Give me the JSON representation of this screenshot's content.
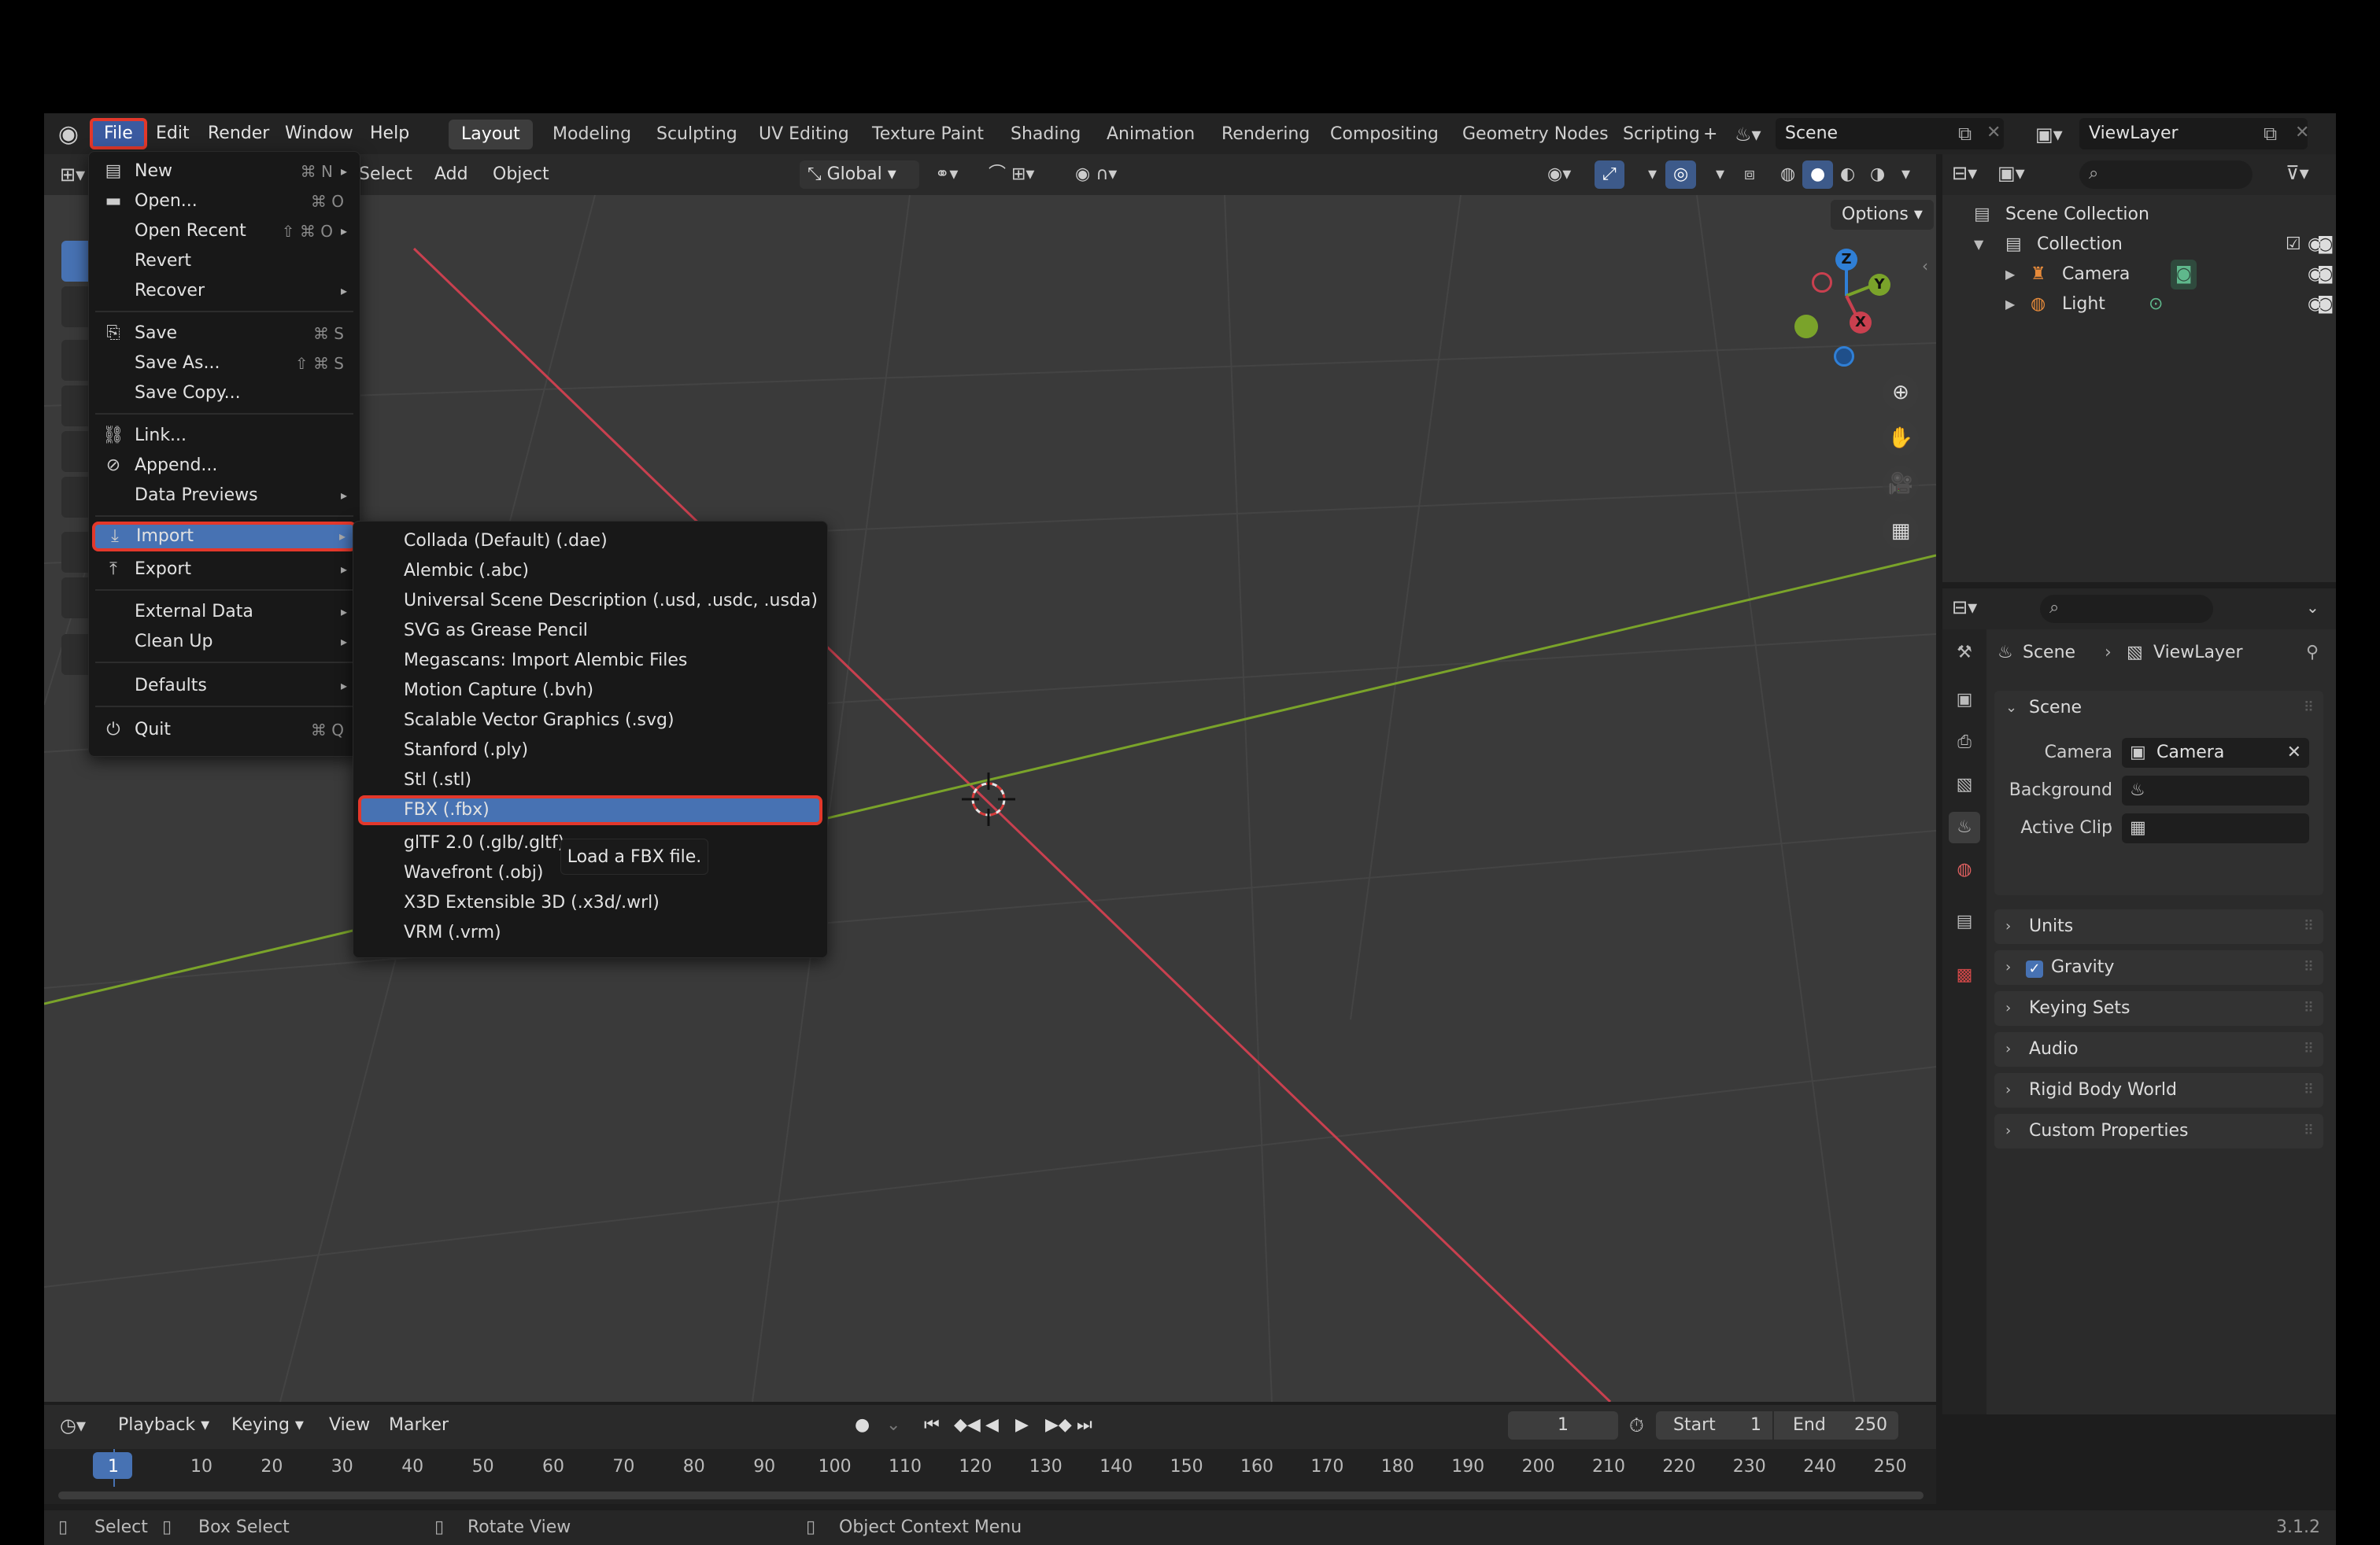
{
  "app": {
    "version": "3.1.2"
  },
  "top_menu": [
    "File",
    "Edit",
    "Render",
    "Window",
    "Help"
  ],
  "workspaces": [
    "Layout",
    "Modeling",
    "Sculpting",
    "UV Editing",
    "Texture Paint",
    "Shading",
    "Animation",
    "Rendering",
    "Compositing",
    "Geometry Nodes",
    "Scripting"
  ],
  "add_workspace": "+",
  "scene_name": "Scene",
  "view_layer": "ViewLayer",
  "viewport_header": {
    "select": "Select",
    "add": "Add",
    "object": "Object",
    "orientation": "Global",
    "options": "Options"
  },
  "gizmo": {
    "z": "Z",
    "y": "Y",
    "x": "X"
  },
  "file_menu": {
    "new": {
      "label": "New",
      "shortcut": "⌘ N"
    },
    "open": {
      "label": "Open...",
      "shortcut": "⌘ O"
    },
    "open_recent": {
      "label": "Open Recent",
      "shortcut": "⇧ ⌘ O"
    },
    "revert": {
      "label": "Revert"
    },
    "recover": {
      "label": "Recover"
    },
    "save": {
      "label": "Save",
      "shortcut": "⌘ S"
    },
    "save_as": {
      "label": "Save As...",
      "shortcut": "⇧ ⌘ S"
    },
    "save_copy": {
      "label": "Save Copy..."
    },
    "link": {
      "label": "Link..."
    },
    "append": {
      "label": "Append..."
    },
    "data_previews": {
      "label": "Data Previews"
    },
    "import": {
      "label": "Import"
    },
    "export": {
      "label": "Export"
    },
    "external_data": {
      "label": "External Data"
    },
    "clean_up": {
      "label": "Clean Up"
    },
    "defaults": {
      "label": "Defaults"
    },
    "quit": {
      "label": "Quit",
      "shortcut": "⌘ Q"
    }
  },
  "import_menu": [
    "Collada (Default) (.dae)",
    "Alembic (.abc)",
    "Universal Scene Description (.usd, .usdc, .usda)",
    "SVG as Grease Pencil",
    "Megascans: Import Alembic Files",
    "Motion Capture (.bvh)",
    "Scalable Vector Graphics (.svg)",
    "Stanford (.ply)",
    "Stl (.stl)",
    "FBX (.fbx)",
    "glTF 2.0 (.glb/.gltf)",
    "Wavefront (.obj)",
    "X3D Extensible 3D (.x3d/.wrl)",
    "VRM (.vrm)"
  ],
  "tooltip": "Load a FBX file.",
  "outliner": {
    "scene_collection": "Scene Collection",
    "collection": "Collection",
    "items": [
      "Camera",
      "Light"
    ]
  },
  "properties": {
    "breadcrumb": {
      "scene": "Scene",
      "view_layer": "ViewLayer"
    },
    "scene_panel": "Scene",
    "camera_label": "Camera",
    "camera_value": "Camera",
    "background_label": "Background ...",
    "active_clip_label": "Active Clip",
    "panels": [
      "Units",
      "Gravity",
      "Keying Sets",
      "Audio",
      "Rigid Body World",
      "Custom Properties"
    ]
  },
  "timeline": {
    "playback": "Playback",
    "keying": "Keying",
    "view": "View",
    "marker": "Marker",
    "current_frame": "1",
    "start_label": "Start",
    "start": "1",
    "end_label": "End",
    "end": "250",
    "frames": [
      "1",
      "10",
      "20",
      "30",
      "40",
      "50",
      "60",
      "70",
      "80",
      "90",
      "100",
      "110",
      "120",
      "130",
      "140",
      "150",
      "160",
      "170",
      "180",
      "190",
      "200",
      "210",
      "220",
      "230",
      "240",
      "250"
    ]
  },
  "status": {
    "select": "Select",
    "box_select": "Box Select",
    "rotate": "Rotate View",
    "context": "Object Context Menu"
  },
  "colors": {
    "accent": "#4772b3",
    "highlight": "#e3382b",
    "x_axis": "#c9404f",
    "y_axis": "#7aa32a",
    "z_axis": "#2f7fd6"
  }
}
